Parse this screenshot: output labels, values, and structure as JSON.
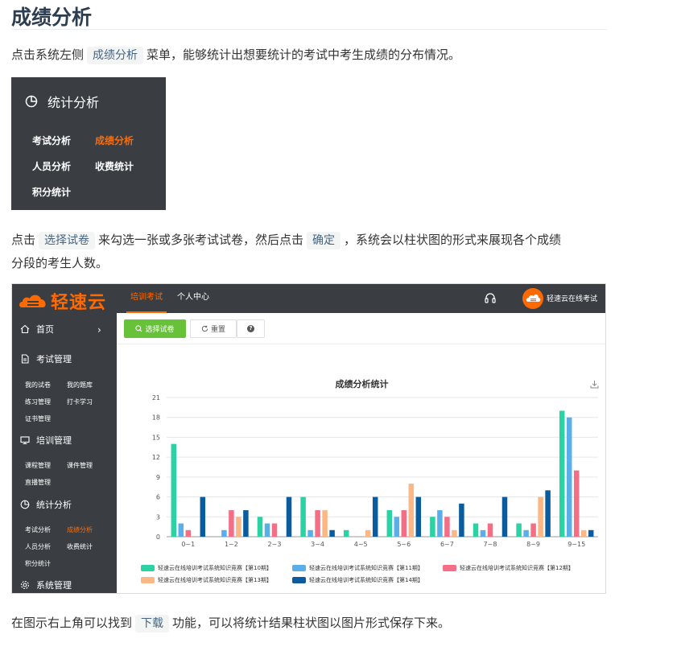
{
  "doc": {
    "title": "成绩分析",
    "p1": {
      "before": "点击系统左侧",
      "code": "成绩分析",
      "after": "菜单，能够统计出想要统计的考试中考生成绩的分布情况。"
    },
    "p2": {
      "t1": "点击",
      "code1": "选择试卷",
      "t2": "来勾选一张或多张考试试卷，然后点击",
      "code2": "确定",
      "t3": "，系统会以柱状图的形式来展现各个成绩",
      "line2": "分段的考生人数。"
    },
    "p3": {
      "before": "在图示右上角可以找到",
      "code": "下载",
      "after": "功能，可以将统计结果柱状图以图片形式保存下来。"
    }
  },
  "menu": {
    "header": "统计分析",
    "items": [
      {
        "label": "考试分析",
        "active": false
      },
      {
        "label": "成绩分析",
        "active": true
      },
      {
        "label": "人员分析",
        "active": false
      },
      {
        "label": "收费统计",
        "active": false
      },
      {
        "label": "积分统计",
        "active": false
      }
    ]
  },
  "app": {
    "logo_text": "轻速云",
    "top_tabs": [
      {
        "label": "培训考试",
        "active": true
      },
      {
        "label": "个人中心",
        "active": false
      }
    ],
    "user_name": "轻速云在线考试",
    "sidebar": {
      "home": "首页",
      "groups": [
        {
          "title": "考试管理",
          "icon": "document-icon",
          "items": [
            "我的试卷",
            "我的题库",
            "练习管理",
            "打卡学习",
            "证书管理"
          ]
        },
        {
          "title": "培训管理",
          "icon": "monitor-icon",
          "items": [
            "课程管理",
            "课件管理",
            "直播管理"
          ]
        },
        {
          "title": "统计分析",
          "icon": "pie-chart-icon",
          "items": [
            "考试分析",
            "成绩分析",
            "人员分析",
            "收费统计",
            "积分统计"
          ],
          "active_item": "成绩分析"
        },
        {
          "title": "系统管理",
          "icon": "gear-icon",
          "items": []
        }
      ]
    },
    "toolbar": {
      "select_label": "选择试卷",
      "reset_label": "重置",
      "help_label": "?"
    },
    "colors": {
      "accent": "#ff6a00",
      "sidebar_bg": "#3a3e43",
      "primary_btn": "#67c23a"
    }
  },
  "chart_data": {
    "type": "bar",
    "title": "成绩分析统计",
    "categories": [
      "0~1",
      "1~2",
      "2~3",
      "3~4",
      "4~5",
      "5~6",
      "6~7",
      "7~8",
      "8~9",
      "9~15"
    ],
    "ylim": [
      0,
      21
    ],
    "yticks": [
      0,
      3,
      6,
      9,
      12,
      15,
      18,
      21
    ],
    "grid": true,
    "legend_position": "bottom",
    "series": [
      {
        "name": "轻速云在线培训考试系统知识竞赛【第10期】",
        "color": "#2ad2a4",
        "values": [
          14,
          0,
          3,
          6,
          1,
          4,
          3,
          2,
          2,
          19
        ]
      },
      {
        "name": "轻速云在线培训考试系统知识竞赛【第11期】",
        "color": "#5aafe9",
        "values": [
          2,
          1,
          2,
          1,
          0,
          3,
          4,
          1,
          1,
          18
        ]
      },
      {
        "name": "轻速云在线培训考试系统知识竞赛【第12期】",
        "color": "#f46e85",
        "values": [
          1,
          4,
          2,
          4,
          0,
          4,
          3,
          2,
          2,
          10
        ]
      },
      {
        "name": "轻速云在线培训考试系统知识竞赛【第13期】",
        "color": "#fbb785",
        "values": [
          0,
          3,
          0,
          4,
          1,
          8,
          1,
          0,
          6,
          1
        ]
      },
      {
        "name": "轻速云在线培训考试系统知识竞赛【第14期】",
        "color": "#0b5c9e",
        "values": [
          6,
          4,
          6,
          1,
          6,
          6,
          5,
          6,
          7,
          1
        ]
      }
    ]
  }
}
